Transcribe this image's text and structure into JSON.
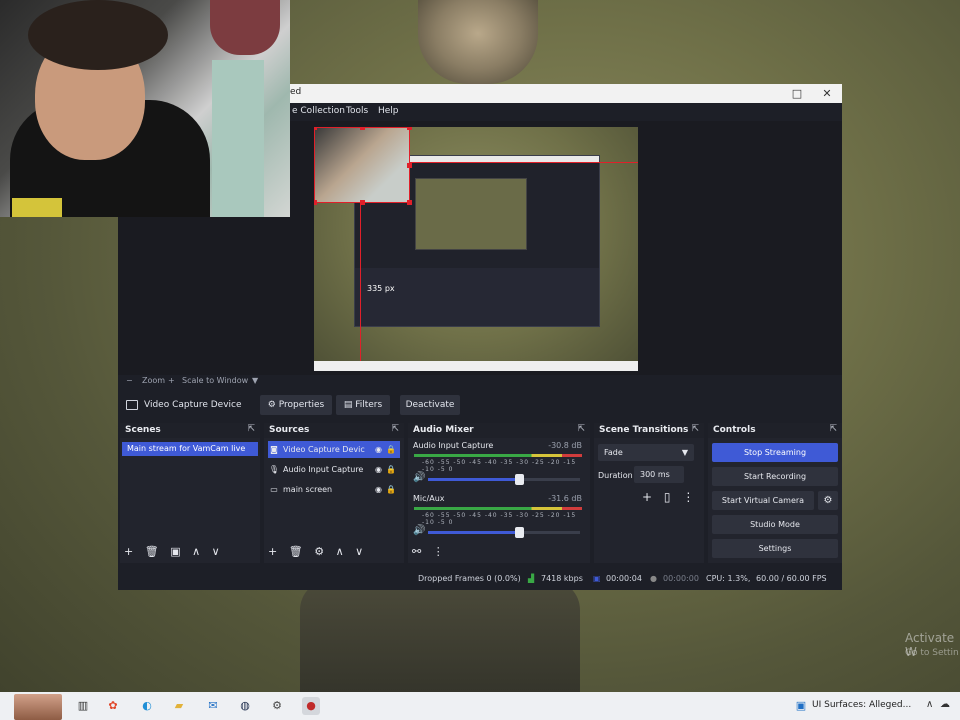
{
  "obs": {
    "title_fragment": "ed",
    "window_buttons": [
      "□",
      "✕"
    ],
    "menu": [
      "e Collection",
      "Tools",
      "Help"
    ],
    "preview": {
      "inner_text": "335 px",
      "zoom_label": "Zoom",
      "scale_label": "Scale to Window"
    },
    "context_bar": {
      "source_label": "Video Capture Device",
      "buttons": [
        "Properties",
        "Filters",
        "Deactivate"
      ]
    },
    "scenes": {
      "title": "Scenes",
      "items": [
        "Main stream for VamCam live"
      ],
      "footer": [
        "+",
        "🗑",
        "▣",
        "∧",
        "∨"
      ]
    },
    "sources": {
      "title": "Sources",
      "items": [
        {
          "icon": "camera",
          "label": "Video Capture Devic",
          "selected": true
        },
        {
          "icon": "microphone",
          "label": "Audio Input Capture",
          "selected": false
        },
        {
          "icon": "monitor",
          "label": "main screen",
          "selected": false
        }
      ],
      "footer": [
        "+",
        "🗑",
        "⚙",
        "∧",
        "∨"
      ]
    },
    "audio_mixer": {
      "title": "Audio Mixer",
      "channels": [
        {
          "name": "Audio Input Capture",
          "db": "-30.8 dB",
          "volume": 0.6
        },
        {
          "name": "Mic/Aux",
          "db": "-31.6 dB",
          "volume": 0.6
        }
      ],
      "ticks": "-60 -55 -50 -45 -40 -35 -30 -25 -20 -15 -10 -5 0"
    },
    "scene_transitions": {
      "title": "Scene Transitions",
      "selected": "Fade",
      "duration_label": "Duration",
      "duration_value": "300 ms"
    },
    "controls": {
      "title": "Controls",
      "buttons": [
        "Stop Streaming",
        "Start Recording",
        "Start Virtual Camera",
        "Studio Mode",
        "Settings"
      ]
    },
    "status": {
      "dropped": "Dropped Frames 0 (0.0%)",
      "kbps": "7418 kbps",
      "stream_time": "00:00:04",
      "rec_time": "00:00:00",
      "cpu": "CPU: 1.3%,",
      "fps": "60.00 / 60.00 FPS"
    }
  },
  "desktop": {
    "activate_title": "Activate W",
    "activate_sub": "Go to Settin"
  },
  "taskbar": {
    "news": "UI Surfaces: Alleged...",
    "tray": [
      "∧",
      "☁",
      "🔊"
    ]
  },
  "colors": {
    "accent": "#3f5ad6",
    "selection": "#e0202a",
    "obs_bg": "#1d1f27"
  }
}
